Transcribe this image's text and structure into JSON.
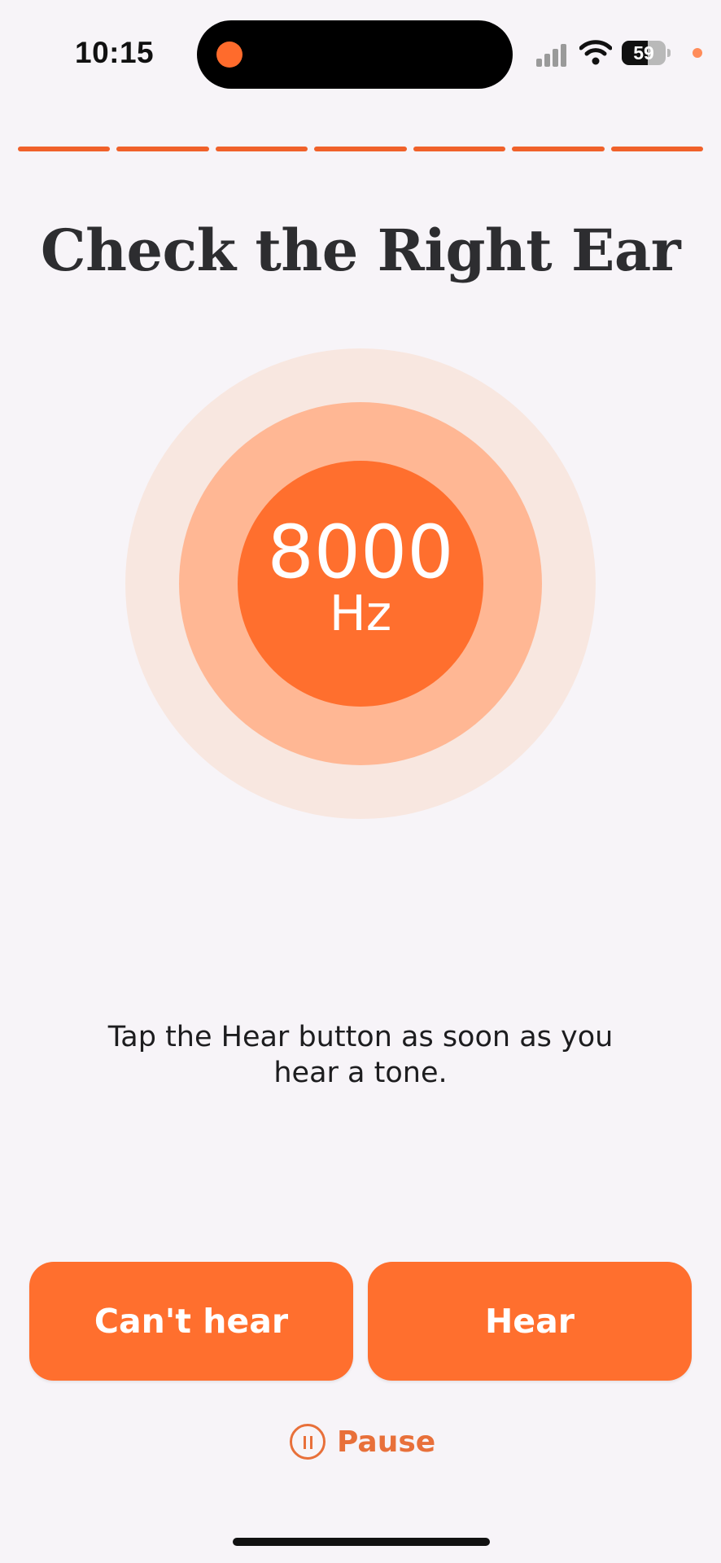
{
  "status_bar": {
    "time": "10:15",
    "battery_percent": "59",
    "battery_level": 0.59,
    "signal_bars": 4,
    "icons": [
      "recording-dot-icon",
      "cellular-signal-icon",
      "wifi-icon",
      "battery-icon",
      "mic-indicator-icon"
    ]
  },
  "progress": {
    "segments_total": 7,
    "segments_complete": 7,
    "color": "#f0612a"
  },
  "title": "Check the Right Ear",
  "tone": {
    "value": "8000",
    "unit": "Hz"
  },
  "instruction": "Tap the Hear button as soon as you hear a tone.",
  "buttons": {
    "cant_hear": "Can't hear",
    "hear": "Hear"
  },
  "pause": {
    "label": "Pause",
    "icon": "pause-circle-icon"
  },
  "colors": {
    "accent": "#ff6f2e",
    "ring_mid": "#ffb794",
    "ring_outer": "#f8e7e0",
    "background": "#f7f4f8"
  }
}
